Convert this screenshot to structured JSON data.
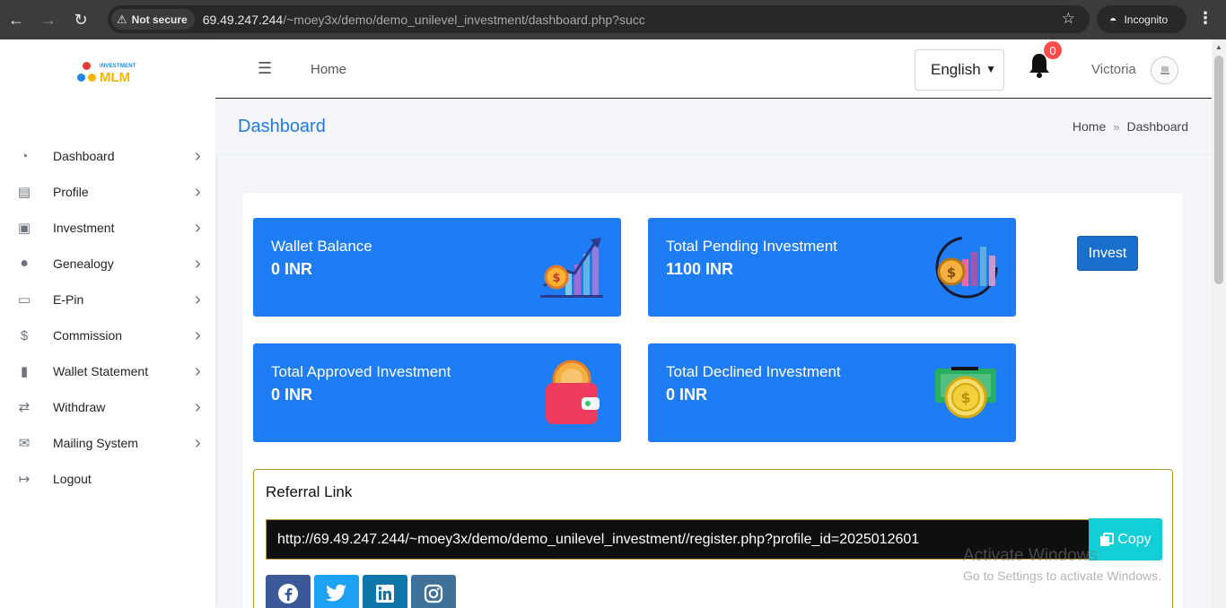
{
  "browser": {
    "security_label": "Not secure",
    "url_host": "69.49.247.244",
    "url_path": "/~moey3x/demo/demo_unilevel_investment/dashboard.php?succ",
    "incognito_label": "Incognito"
  },
  "brand": {
    "small_text": "INVESTMENT",
    "big_text": "MLM",
    "colors": {
      "red": "#e53935",
      "blue": "#1e88e5",
      "yellow": "#f4b400"
    }
  },
  "sidebar": {
    "items": [
      {
        "label": "Dashboard",
        "icon": "gauge-icon",
        "glyph": "◔",
        "has_submenu": true
      },
      {
        "label": "Profile",
        "icon": "id-card-icon",
        "glyph": "▤",
        "has_submenu": true
      },
      {
        "label": "Investment",
        "icon": "money-bill-icon",
        "glyph": "▣",
        "has_submenu": true
      },
      {
        "label": "Genealogy",
        "icon": "sitemap-icon",
        "glyph": "⚫",
        "has_submenu": true
      },
      {
        "label": "E-Pin",
        "icon": "credit-card-icon",
        "glyph": "▭",
        "has_submenu": true
      },
      {
        "label": "Commission",
        "icon": "dollar-icon",
        "glyph": "$",
        "has_submenu": true
      },
      {
        "label": "Wallet Statement",
        "icon": "briefcase-icon",
        "glyph": "▮",
        "has_submenu": true
      },
      {
        "label": "Withdraw",
        "icon": "exchange-icon",
        "glyph": "⇄",
        "has_submenu": true
      },
      {
        "label": "Mailing System",
        "icon": "envelope-icon",
        "glyph": "✉",
        "has_submenu": true
      },
      {
        "label": "Logout",
        "icon": "sign-out-icon",
        "glyph": "↦",
        "has_submenu": false
      }
    ]
  },
  "header": {
    "home_label": "Home",
    "language": "English",
    "notification_count": "0",
    "username": "Victoria"
  },
  "page": {
    "title": "Dashboard",
    "breadcrumb": [
      "Home",
      "Dashboard"
    ]
  },
  "stats": [
    {
      "title": "Wallet Balance",
      "value": "0 INR",
      "icon": "growth-chart-icon"
    },
    {
      "title": "Total Pending Investment",
      "value": "1100 INR",
      "icon": "pending-investment-icon"
    },
    {
      "title": "Total Approved Investment",
      "value": "0 INR",
      "icon": "wallet-coin-icon"
    },
    {
      "title": "Total Declined Investment",
      "value": "0 INR",
      "icon": "cash-coin-icon"
    }
  ],
  "invest_button": "Invest",
  "referral": {
    "title": "Referral Link",
    "link": "http://69.49.247.244/~moey3x/demo/demo_unilevel_investment//register.php?profile_id=2025012601",
    "copy_label": "Copy",
    "socials": [
      {
        "name": "facebook",
        "color": "#3b5998"
      },
      {
        "name": "twitter",
        "color": "#1da1f2"
      },
      {
        "name": "linkedin",
        "color": "#0e76a8"
      },
      {
        "name": "instagram",
        "color": "#3f729b"
      }
    ]
  },
  "watermark": {
    "line1": "Activate Windows",
    "line2": "Go to Settings to activate Windows."
  },
  "colors": {
    "accent_blue": "#1e7cf5",
    "title_blue": "#1f7ae0",
    "copy_cyan": "#12cfd7",
    "badge_red": "#ff4d4d"
  }
}
